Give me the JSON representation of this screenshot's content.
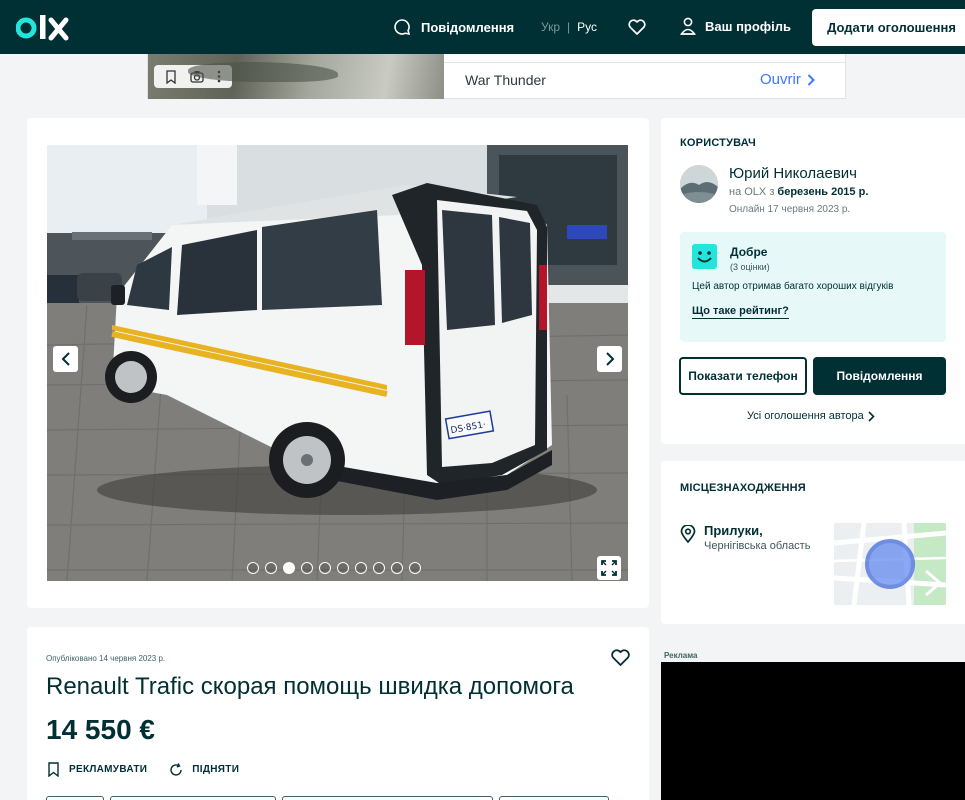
{
  "header": {
    "logo_alt": "olx",
    "messages_label": "Повідомлення",
    "lang_ukr": "Укр",
    "lang_separator": "|",
    "lang_rus": "Рус",
    "profile_label": "Ваш профіль",
    "post_ad_label": "Додати оголошення"
  },
  "top_ad": {
    "title": "War Thunder",
    "open_label": "Ouvrir"
  },
  "gallery": {
    "image_count": 10,
    "active_index": 2
  },
  "user": {
    "section_title": "КОРИСТУВАЧ",
    "name": "Юрий Николаевич",
    "since_prefix": "на OLX з",
    "since_date": "березень 2015 р.",
    "online": "Онлайн 17 червня 2023 р.",
    "rating_title": "Добре",
    "rating_count": "(3 оцінки)",
    "rating_desc": "Цей автор отримав багато хороших відгуків",
    "rating_link": "Що таке рейтинг?",
    "show_phone": "Показати телефон",
    "message_button": "Повідомлення",
    "all_ads": "Усі оголошення автора"
  },
  "location": {
    "section_title": "МІСЦЕЗНАХОДЖЕННЯ",
    "city": "Прилуки,",
    "region": "Чернігівська область"
  },
  "ad": {
    "published": "Опубліковано 14 червня 2023 р.",
    "title": "Renault Trafic скорая помощь швидка допомога",
    "price": "14 550 €",
    "promote_label": "РЕКЛАМУВАТИ",
    "raise_label": "ПІДНЯТИ"
  },
  "side_ad": {
    "label": "Реклама"
  },
  "colors": {
    "brand_dark": "#002f34",
    "accent_teal": "#23e5db",
    "rating_bg": "#e6f8f8",
    "link_blue": "#3a77ff"
  }
}
